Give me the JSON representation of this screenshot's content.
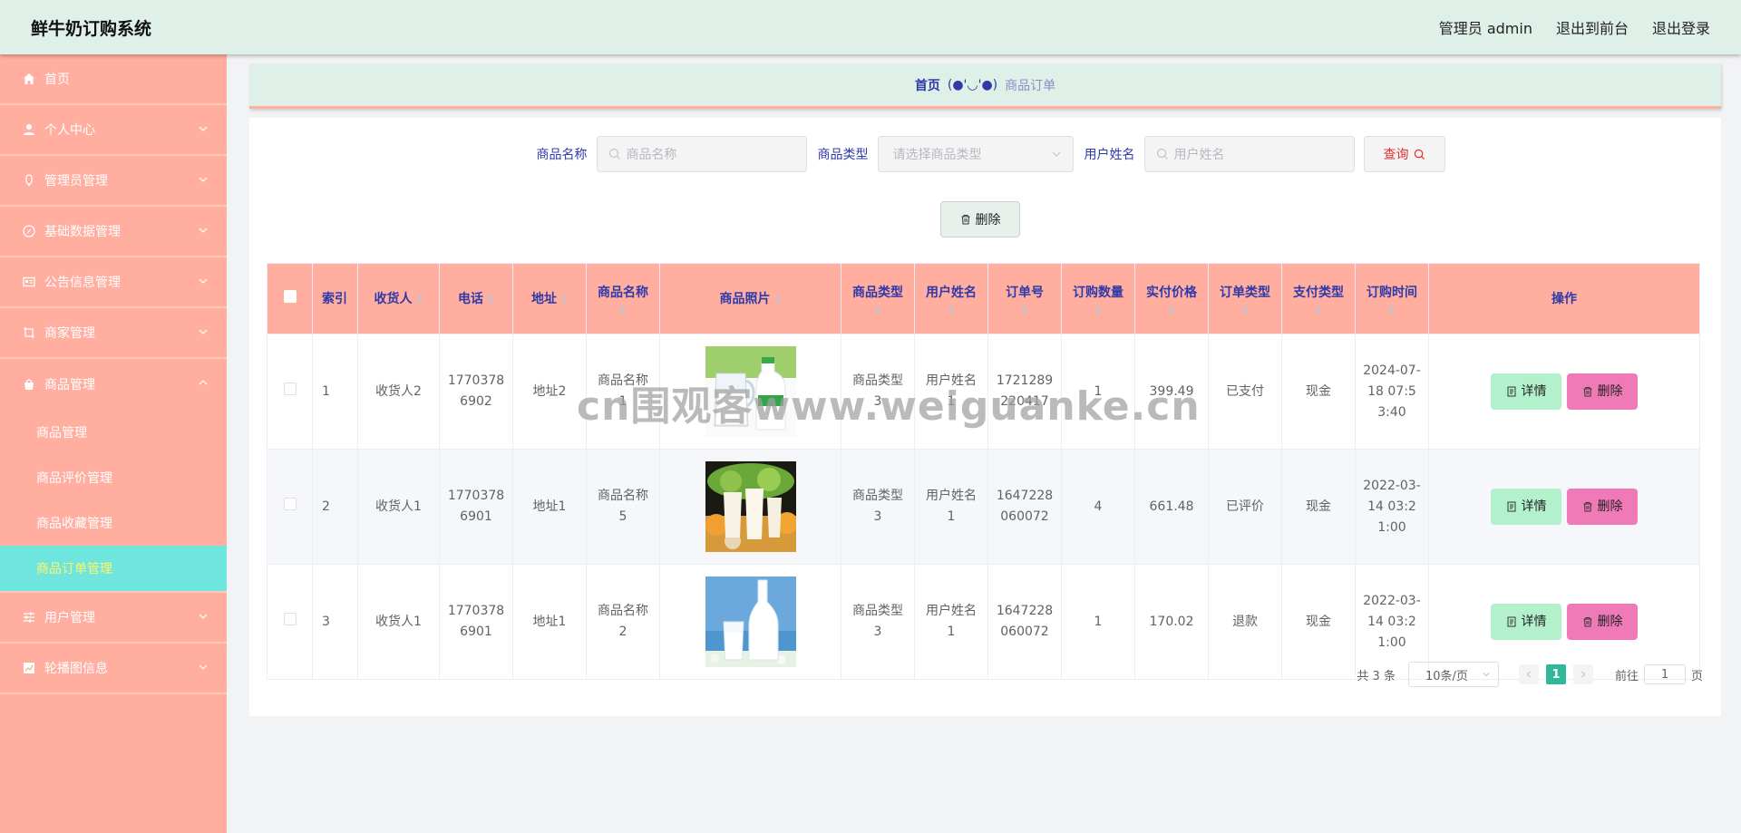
{
  "header": {
    "title": "鲜牛奶订购系统",
    "admin_label": "管理员 admin",
    "to_front": "退出到前台",
    "logout": "退出登录"
  },
  "sidebar": {
    "items": [
      {
        "label": "首页",
        "icon": "home-icon"
      },
      {
        "label": "个人中心",
        "icon": "user-icon"
      },
      {
        "label": "管理员管理",
        "icon": "admin-icon"
      },
      {
        "label": "基础数据管理",
        "icon": "compass-icon"
      },
      {
        "label": "公告信息管理",
        "icon": "notice-icon"
      },
      {
        "label": "商家管理",
        "icon": "crop-icon"
      },
      {
        "label": "商品管理",
        "icon": "goods-icon"
      },
      {
        "label": "用户管理",
        "icon": "sliders-icon"
      },
      {
        "label": "轮播图信息",
        "icon": "chart-icon"
      }
    ],
    "sub_items": [
      "商品管理",
      "商品评价管理",
      "商品收藏管理",
      "商品订单管理"
    ]
  },
  "breadcrumb": {
    "home": "首页",
    "sep": "(●'◡'●)",
    "current": "商品订单"
  },
  "search": {
    "name_label": "商品名称",
    "name_placeholder": "商品名称",
    "type_label": "商品类型",
    "type_placeholder": "请选择商品类型",
    "user_label": "用户姓名",
    "user_placeholder": "用户姓名",
    "query_label": "查询"
  },
  "toolbar": {
    "delete_label": "删除"
  },
  "table": {
    "headers": [
      "索引",
      "收货人",
      "电话",
      "地址",
      "商品名称",
      "商品照片",
      "商品类型",
      "用户姓名",
      "订单号",
      "订购数量",
      "实付价格",
      "订单类型",
      "支付类型",
      "订购时间",
      "操作"
    ],
    "detail_label": "详情",
    "delete_label": "删除",
    "rows": [
      {
        "index": "1",
        "receiver": "收货人2",
        "phone": "17703786902",
        "address": "地址2",
        "goods_name": "商品名称1",
        "goods_type": "商品类型3",
        "user_name": "用户姓名1",
        "order_no": "1721289220417",
        "qty": "1",
        "price": "399.49",
        "order_type": "已支付",
        "pay_type": "现金",
        "time": "2024-07-18 07:53:40"
      },
      {
        "index": "2",
        "receiver": "收货人1",
        "phone": "17703786901",
        "address": "地址1",
        "goods_name": "商品名称5",
        "goods_type": "商品类型3",
        "user_name": "用户姓名1",
        "order_no": "1647228060072",
        "qty": "4",
        "price": "661.48",
        "order_type": "已评价",
        "pay_type": "现金",
        "time": "2022-03-14 03:21:00"
      },
      {
        "index": "3",
        "receiver": "收货人1",
        "phone": "17703786901",
        "address": "地址1",
        "goods_name": "商品名称2",
        "goods_type": "商品类型3",
        "user_name": "用户姓名1",
        "order_no": "1647228060072",
        "qty": "1",
        "price": "170.02",
        "order_type": "退款",
        "pay_type": "现金",
        "time": "2022-03-14 03:21:00"
      }
    ]
  },
  "pagination": {
    "total": "共 3 条",
    "page_size": "10条/页",
    "current_page": "1",
    "goto_label": "前往",
    "goto_value": "1",
    "page_unit": "页"
  },
  "watermark": "cn围观客www.weiguanke.cn",
  "colors": {
    "header_bg": "#dff0e8",
    "sidebar_bg": "#ffaea0",
    "active_sub_bg": "#6fe6dd",
    "active_sub_text": "#fff56a",
    "table_header_bg": "#ffaea0",
    "label_blue": "#2f3aa8",
    "detail_btn": "#b3f0cc",
    "delete_btn": "#f07ab8",
    "pager_active": "#2fb99a"
  }
}
